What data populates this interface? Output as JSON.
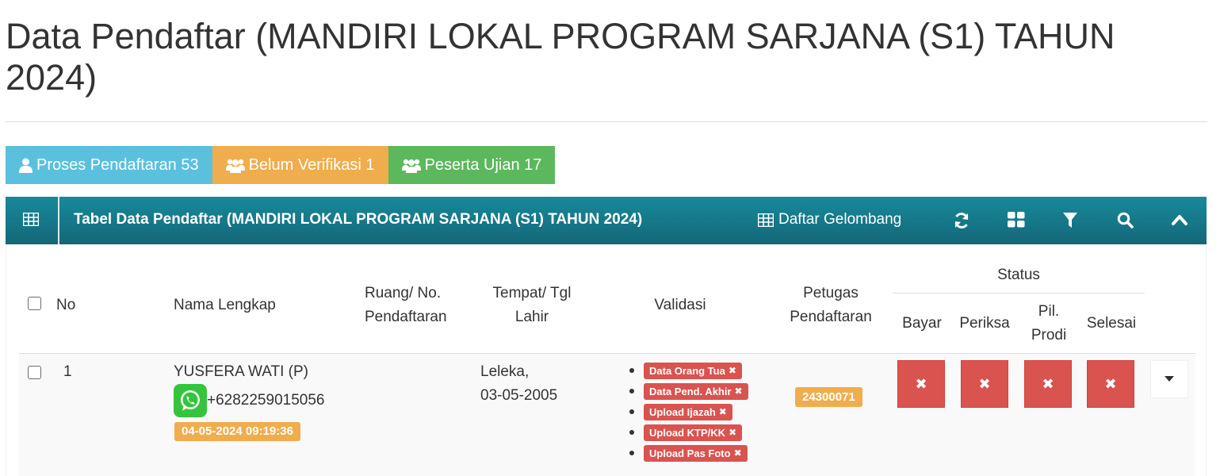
{
  "page": {
    "title": "Data Pendaftar (MANDIRI LOKAL PROGRAM SARJANA (S1) TAHUN 2024)"
  },
  "stats": [
    {
      "label": "Proses Pendaftaran 53",
      "icon": "user-icon",
      "color": "#5bc0de"
    },
    {
      "label": "Belum Verifikasi 1",
      "icon": "users-icon",
      "color": "#f0ad4e"
    },
    {
      "label": "Peserta Ujian 17",
      "icon": "users-icon",
      "color": "#5cb85c"
    }
  ],
  "panel": {
    "title": "Tabel Data Pendaftar (MANDIRI LOKAL PROGRAM SARJANA (S1) TAHUN 2024)",
    "link_label": "Daftar Gelombang",
    "header_color": "#16798a",
    "tools": [
      "refresh-icon",
      "layout-icon",
      "filter-icon",
      "search-icon",
      "collapse-icon"
    ]
  },
  "table": {
    "headers": {
      "no": "No",
      "nama": "Nama Lengkap",
      "ruang_line1": "Ruang/ No.",
      "ruang_line2": "Pendaftaran",
      "tempat_line1": "Tempat/ Tgl",
      "tempat_line2": "Lahir",
      "validasi": "Validasi",
      "petugas_line1": "Petugas",
      "petugas_line2": "Pendaftaran",
      "status": "Status",
      "bayar": "Bayar",
      "periksa": "Periksa",
      "pil_line1": "Pil.",
      "pil_line2": "Prodi",
      "selesai": "Selesai"
    },
    "rows": [
      {
        "no": "1",
        "nama": "YUSFERA WATI (P)",
        "phone": "+6282259015056",
        "timestamp": "04-05-2024 09:19:36",
        "tempat": "Leleka,",
        "tgl_lahir": "03-05-2005",
        "validasi": [
          "Data Orang Tua",
          "Data Pend. Akhir",
          "Upload Ijazah",
          "Upload KTP/KK",
          "Upload Pas Foto"
        ],
        "petugas": "24300071",
        "status_icon": "✖"
      }
    ]
  }
}
